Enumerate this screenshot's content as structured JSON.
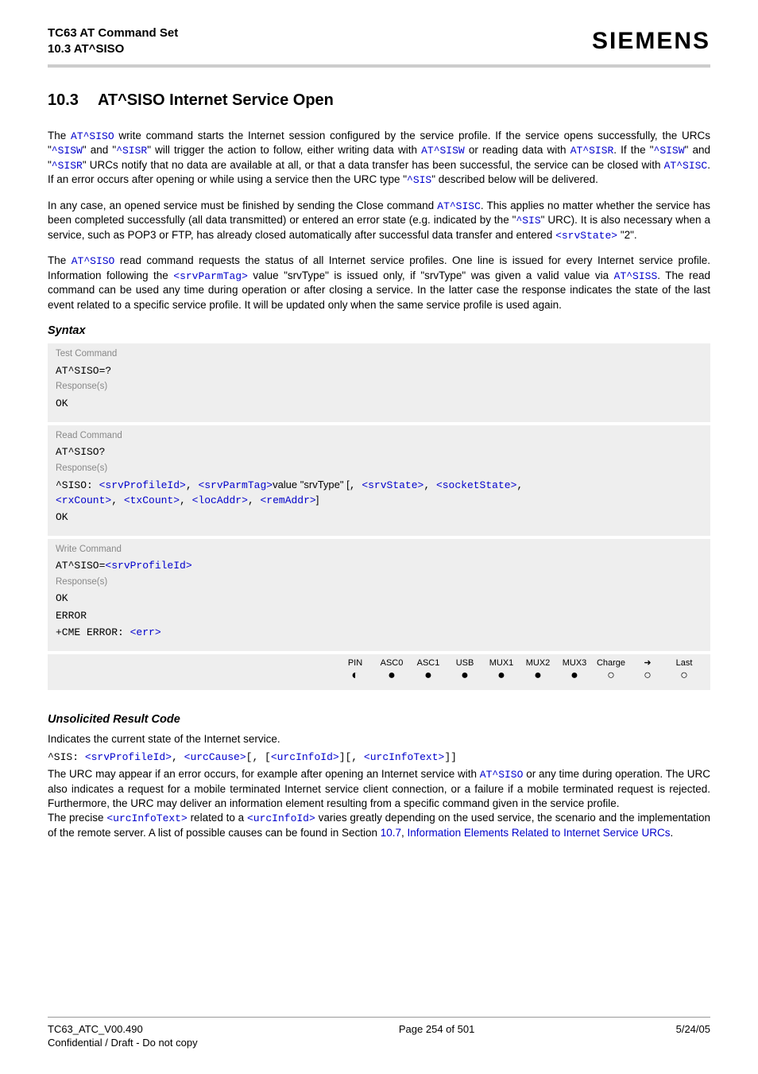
{
  "header": {
    "doc_title": "TC63 AT Command Set",
    "doc_sub": "10.3 AT^SISO",
    "brand": "SIEMENS"
  },
  "section": {
    "number": "10.3",
    "title": "AT^SISO   Internet Service Open"
  },
  "p1": {
    "t1": "The ",
    "c1": "AT^SISO",
    "t2": " write command starts the Internet session configured by the service profile. If the service opens successfully, the URCs \"",
    "c2": "^SISW",
    "t3": "\" and \"",
    "c3": "^SISR",
    "t4": "\" will trigger the action to follow, either writing data with ",
    "c4": "AT^SISW",
    "t5": " or reading data with ",
    "c5": "AT^SISR",
    "t6": ". If the \"",
    "c6": "^SISW",
    "t7": "\" and \"",
    "c7": "^SISR",
    "t8": "\" URCs notify that no data are available at all, or that a data transfer has been successful, the service can be closed with ",
    "c8": "AT^SISC",
    "t9": ". If an error occurs after opening or while using a service then the URC type \"",
    "c9": "^SIS",
    "t10": "\" described below will be delivered."
  },
  "p2": {
    "t1": "In any case, an opened service must be finished by sending the Close command ",
    "c1": "AT^SISC",
    "t2": ". This applies no matter whether the service has been completed successfully (all data transmitted) or entered an error state (e.g. indicated by the \"",
    "c2": "^SIS",
    "t3": "\" URC). It is also necessary when a service, such as POP3 or FTP, has already closed automatically after successful data transfer and entered ",
    "c3": "<srvState>",
    "t4": " \"2\"."
  },
  "p3": {
    "t1": "The ",
    "c1": "AT^SISO",
    "t2": " read command requests the status of all Internet service profiles. One line is issued for every Internet service profile. Information following the ",
    "c2": "<srvParmTag>",
    "t3": " value \"srvType\" is issued only, if \"srvType\" was given a valid value via ",
    "c3": "AT^SISS",
    "t4": ". The read command can be used any time during operation or after closing a service. In the latter case the response indicates the state of the last event related to a specific service profile. It will be updated only when the same service profile is used again."
  },
  "syntax_heading": "Syntax",
  "test_cmd": {
    "label": "Test Command",
    "cmd": "AT^SISO=?",
    "resp_label": "Response(s)",
    "ok": "OK"
  },
  "read_cmd": {
    "label": "Read Command",
    "cmd": "AT^SISO?",
    "resp_label": "Response(s)",
    "line_prefix": "^SISO: ",
    "p_srvProfileId": "<srvProfileId>",
    "sep1": ", ",
    "p_srvParmTag": "<srvParmTag>",
    "midtext": "value \"srvType\" [",
    "sep2": ", ",
    "p_srvState": "<srvState>",
    "sep3": ", ",
    "p_socketState": "<socketState>",
    "sep4": ", ",
    "p_rxCount": "<rxCount>",
    "sep5": ", ",
    "p_txCount": "<txCount>",
    "sep6": ", ",
    "p_locAddr": "<locAddr>",
    "sep7": ", ",
    "p_remAddr": "<remAddr>",
    "endbracket": "]",
    "ok": "OK"
  },
  "write_cmd": {
    "label": "Write Command",
    "cmd_prefix": "AT^SISO=",
    "p_srvProfileId": "<srvProfileId>",
    "resp_label": "Response(s)",
    "ok": "OK",
    "error": "ERROR",
    "cme_prefix": "+CME ERROR: ",
    "p_err": "<err>"
  },
  "availability": {
    "headers": [
      "PIN",
      "ASC0",
      "ASC1",
      "USB",
      "MUX1",
      "MUX2",
      "MUX3",
      "Charge",
      "➜",
      "Last"
    ],
    "values": [
      "◐",
      "●",
      "●",
      "●",
      "●",
      "●",
      "●",
      "○",
      "○",
      "○"
    ]
  },
  "urc": {
    "heading": "Unsolicited Result Code",
    "intro": "Indicates the current state of the Internet service.",
    "fmt_prefix": "^SIS: ",
    "p_srvProfileId": "<srvProfileId>",
    "s1": ", ",
    "p_urcCause": "<urcCause>",
    "s2": "[, [",
    "p_urcInfoId": "<urcInfoId>",
    "s3": "][, ",
    "p_urcInfoText": "<urcInfoText>",
    "s4": "]]",
    "body_t1": "The URC may appear if an error occurs, for example after opening an Internet service with ",
    "body_c1": "AT^SISO",
    "body_t2": " or any time during operation. The URC also indicates a request for a mobile terminated Internet service client connection, or a failure if a mobile terminated request is rejected. Furthermore, the URC may deliver an information element resulting from a specific command given in the service profile.",
    "body2_t1": "The precise ",
    "body2_c1": "<urcInfoText>",
    "body2_t2": " related to a ",
    "body2_c2": "<urcInfoId>",
    "body2_t3": " varies greatly depending on the used service, the scenario and the implementation of the remote server. A list of possible causes can be found in Section ",
    "body2_link1": "10.7",
    "body2_t4": ", ",
    "body2_link2": "Information Elements Related to Internet Service URCs",
    "body2_t5": "."
  },
  "footer": {
    "left1": "TC63_ATC_V00.490",
    "left2": "Confidential / Draft - Do not copy",
    "center": "Page 254 of 501",
    "right": "5/24/05"
  }
}
